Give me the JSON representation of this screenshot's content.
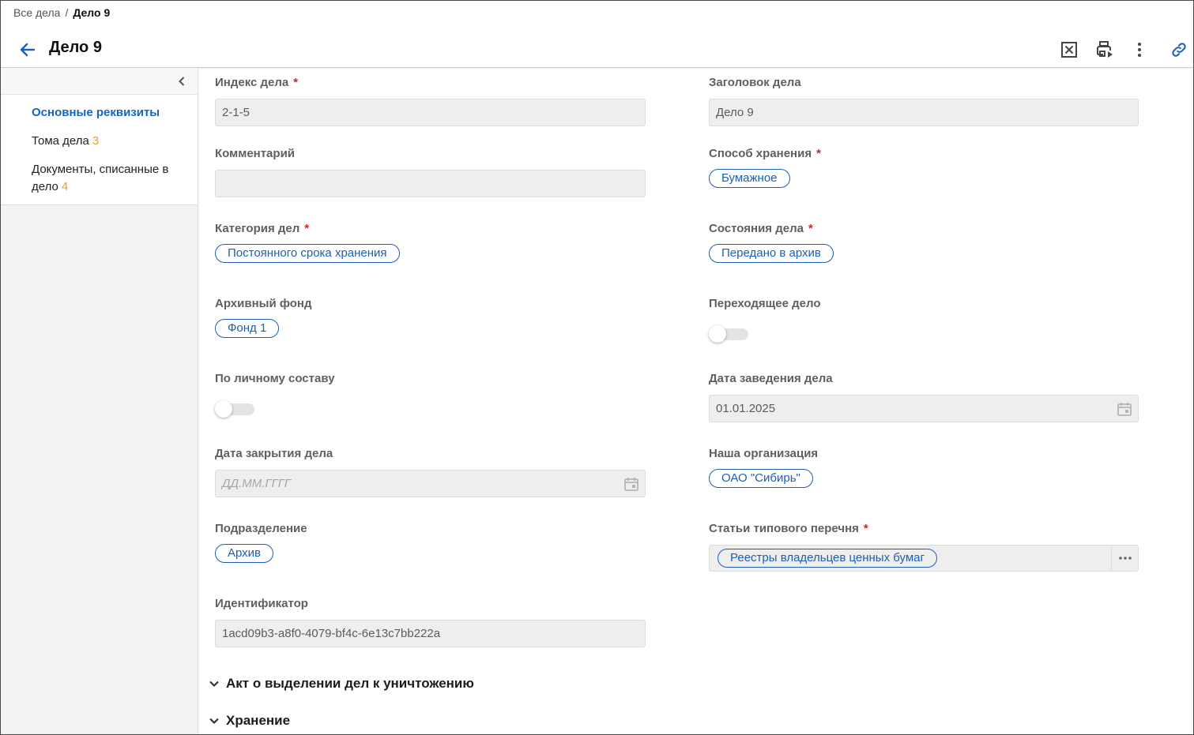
{
  "breadcrumb": {
    "root": "Все дела",
    "separator": "/",
    "current": "Дело 9"
  },
  "header": {
    "title": "Дело 9"
  },
  "colors": {
    "accent": "#1e5fb3",
    "required": "#c62828",
    "count": "#f0a020"
  },
  "toolbar_icons": [
    "close-box-icon",
    "print-icon",
    "more-vertical-icon",
    "link-icon"
  ],
  "sidebar": {
    "items": [
      {
        "label": "Основные реквизиты",
        "active": true
      },
      {
        "label": "Тома дела",
        "count": "3"
      },
      {
        "label": "Документы, списанные в дело",
        "count": "4"
      }
    ]
  },
  "form": {
    "index": {
      "label": "Индекс дела",
      "required": "*",
      "value": "2-1-5"
    },
    "title": {
      "label": "Заголовок дела",
      "value": "Дело 9"
    },
    "comment": {
      "label": "Комментарий",
      "value": ""
    },
    "storage_method": {
      "label": "Способ хранения",
      "required": "*",
      "chip": "Бумажное"
    },
    "category": {
      "label": "Категория дел",
      "required": "*",
      "chip": "Постоянного срока хранения"
    },
    "state": {
      "label": "Состояния дела",
      "required": "*",
      "chip": "Передано в архив"
    },
    "archive_fund": {
      "label": "Архивный фонд",
      "chip": "Фонд 1"
    },
    "transitional": {
      "label": "Переходящее дело",
      "on": false
    },
    "personnel": {
      "label": "По личному составу",
      "on": false
    },
    "open_date": {
      "label": "Дата заведения дела",
      "value": "01.01.2025"
    },
    "close_date": {
      "label": "Дата закрытия дела",
      "placeholder": "ДД.ММ.ГГГГ"
    },
    "organization": {
      "label": "Наша организация",
      "chip": "ОАО \"Сибирь\""
    },
    "department": {
      "label": "Подразделение",
      "chip": "Архив"
    },
    "articles": {
      "label": "Статьи типового перечня",
      "required": "*",
      "chip": "Реестры владельцев ценных бумаг"
    },
    "identifier": {
      "label": "Идентификатор",
      "value": "1acd09b3-a8f0-4079-bf4c-6e13c7bb222a"
    }
  },
  "sections": [
    {
      "title": "Акт о выделении дел к уничтожению"
    },
    {
      "title": "Хранение"
    }
  ]
}
